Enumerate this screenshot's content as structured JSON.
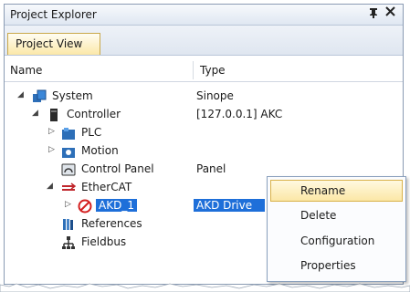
{
  "panel": {
    "title": "Project Explorer",
    "pin_icon": "pin-icon",
    "close_icon": "close-icon"
  },
  "tabs": [
    {
      "label": "Project View",
      "active": true
    }
  ],
  "columns": {
    "name": "Name",
    "type": "Type"
  },
  "tree": [
    {
      "name": "System",
      "type": "Sinope",
      "level": 0,
      "expander": "expanded",
      "icon": "system-icon"
    },
    {
      "name": "Controller",
      "type": "[127.0.0.1] AKC",
      "level": 1,
      "expander": "expanded",
      "icon": "controller-icon"
    },
    {
      "name": "PLC",
      "type": "",
      "level": 2,
      "expander": "collapsed",
      "icon": "plc-icon"
    },
    {
      "name": "Motion",
      "type": "",
      "level": 2,
      "expander": "collapsed",
      "icon": "motion-icon"
    },
    {
      "name": "Control Panel",
      "type": "Panel",
      "level": 2,
      "expander": "none",
      "icon": "control-panel-icon"
    },
    {
      "name": "EtherCAT",
      "type": "",
      "level": 2,
      "expander": "expanded",
      "icon": "ethercat-icon"
    },
    {
      "name": "AKD_1",
      "type": "AKD Drive",
      "level": 3,
      "expander": "collapsed",
      "icon": "disabled-icon",
      "selected": true
    },
    {
      "name": "References",
      "type": "",
      "level": 2,
      "expander": "none",
      "icon": "references-icon"
    },
    {
      "name": "Fieldbus",
      "type": "",
      "level": 2,
      "expander": "none",
      "icon": "fieldbus-icon"
    }
  ],
  "context_menu": {
    "items": [
      {
        "label": "Rename",
        "highlighted": true
      },
      {
        "label": "Delete",
        "highlighted": false
      },
      {
        "label": "Configuration",
        "highlighted": false
      },
      {
        "label": "Properties",
        "highlighted": false
      }
    ]
  },
  "colors": {
    "selection": "#1e6fd9",
    "tab_active": "#fbe8a8",
    "menu_highlight": "#fbe7a6",
    "disabled_red": "#d42020"
  }
}
